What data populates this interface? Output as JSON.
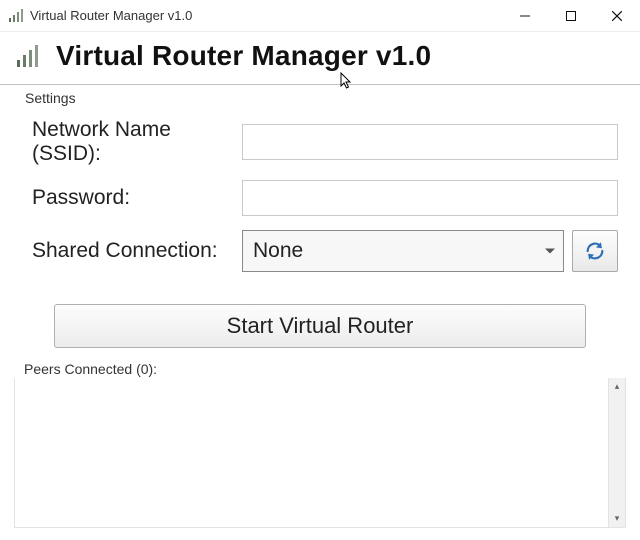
{
  "window": {
    "title": "Virtual Router Manager v1.0"
  },
  "header": {
    "title": "Virtual Router Manager v1.0"
  },
  "settings": {
    "group_label": "Settings",
    "ssid_label": "Network Name (SSID):",
    "ssid_value": "",
    "password_label": "Password:",
    "password_value": "",
    "shared_label": "Shared Connection:",
    "shared_selected": "None"
  },
  "actions": {
    "start_label": "Start Virtual Router"
  },
  "peers": {
    "label": "Peers Connected (0):",
    "count": 0
  }
}
